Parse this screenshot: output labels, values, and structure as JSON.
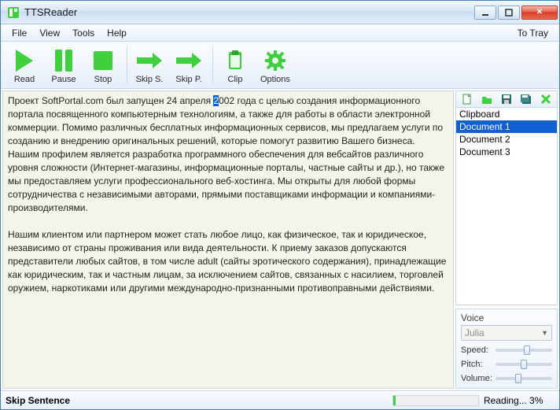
{
  "titlebar": {
    "title": "TTSReader"
  },
  "menubar": {
    "items": [
      "File",
      "View",
      "Tools",
      "Help"
    ],
    "to_tray": "To Tray"
  },
  "toolbar": {
    "read": "Read",
    "pause": "Pause",
    "stop": "Stop",
    "skip_s": "Skip S.",
    "skip_p": "Skip P.",
    "clip": "Clip",
    "options": "Options"
  },
  "document": {
    "pre": "Проект SoftPortal.com был запущен 24 апреля ",
    "highlight": "2",
    "post": "002 года с целью создания информационного портала посвященного компьютерным технологиям, а также для работы в области электронной коммерции. Помимо различных бесплатных информационных сервисов, мы предлагаем услуги по созданию и внедрению оригинальных решений, которые помогут развитию Вашего бизнеса. Нашим профилем является разработка программного обеспечения для вебсайтов различного уровня сложности (Интернет-магазины, информационные порталы, частные сайты и др.), но также мы предоставляем услуги профессионального веб-хостинга. Мы открыты для любой формы сотрудничества с независимыми авторами, прямыми поставщиками информации и компаниями-производителями.\n\nНашим клиентом или партнером может стать любое лицо, как физическое, так и юридическое, независимо от страны проживания или вида деятельности. К приему заказов допускаются представители любых сайтов, в том числе adult (сайты эротического содержания), принадлежащие как юридическим, так и частным лицам, за исключением сайтов, связанных с насилием, торговлей оружием, наркотиками или другими международно-признанными противоправными действиями."
  },
  "documents": {
    "items": [
      "Clipboard",
      "Document 1",
      "Document 2",
      "Document 3"
    ],
    "selected_index": 1
  },
  "voice": {
    "label": "Voice",
    "selected": "Julia",
    "speed_label": "Speed:",
    "pitch_label": "Pitch:",
    "volume_label": "Volume:",
    "speed_pct": 50,
    "pitch_pct": 45,
    "volume_pct": 35
  },
  "status": {
    "left": "Skip Sentence",
    "progress_pct": 3,
    "right": "Reading... 3%"
  },
  "colors": {
    "accent_green": "#3fcf3f",
    "selection_blue": "#1060d0"
  }
}
